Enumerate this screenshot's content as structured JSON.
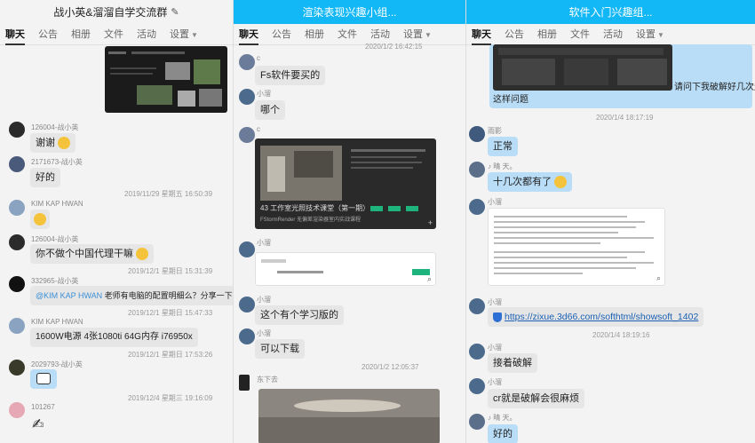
{
  "tab_labels": [
    "聊天",
    "公告",
    "相册",
    "文件",
    "活动",
    "设置"
  ],
  "p1": {
    "title": "战小英&溜溜自学交流群",
    "messages": {
      "m1_name": "126004-战小英",
      "m1_text": "谢谢",
      "m2_name": "2171673-战小英",
      "m2_text": "好的",
      "t1": "2019/11/29 星期五 16:50:39",
      "m3_name": "KIM KAP HWAN",
      "m4_name": "126004-战小英",
      "m4_text": "你不做个中国代理干嘛",
      "t2": "2019/12/1 星期日 15:31:39",
      "m5_name": "332965-战小英",
      "m5_mention": "@KIM KAP HWAN",
      "m5_text": " 老师有电脑的配置明细么？分享一下呗？",
      "t3": "2019/12/1 星期日 15:47:33",
      "m6_name": "KIM KAP HWAN",
      "m6_text": "1600W电源 4张1080ti 64G内存 i76950x",
      "t4": "2019/12/1 星期日 17:53:26",
      "m7_name": "2029793-战小英",
      "t5": "2019/12/4 星期三 19:16:09",
      "m8_name": "101267"
    }
  },
  "p2": {
    "title": "渲染表现兴趣小组...",
    "t1": "2020/1/2 16:42:15",
    "m1_name": "c",
    "m1_text": "Fs软件要买的",
    "m2_name": "小溜",
    "m2_text": "哪个",
    "m3_name": "c",
    "card_text": "43 工作室光照技术课堂（第一期）",
    "card_sub": "FStormRender 无偏差渲染器室内实战课程",
    "m4_name": "小溜",
    "m5_name": "小溜",
    "m5_text": "这个有个学习版的",
    "m6_name": "小溜",
    "m6_text": "可以下载",
    "t2": "2020/1/2 12:05:37",
    "m7_name": "东下去"
  },
  "p3": {
    "title": "软件入门兴趣组...",
    "m0_text": "请问下我破解好几次还是",
    "m0_text2": "这样问题",
    "t1": "2020/1/4 18:17:19",
    "m1_name": "雨影",
    "m1_text": "正常",
    "m2_name": "♪ 晴 天。",
    "m2_text": "十几次都有了",
    "m3_name": "小溜",
    "m4_name": "小溜",
    "m4_link": "https://zixue.3d66.com/softhtml/showsoft_1402",
    "t2": "2020/1/4 18:19:16",
    "m5_name": "小溜",
    "m5_text": "接着破解",
    "m6_name": "小溜",
    "m6_text": "cr就是破解会很麻烦",
    "m7_name": "♪ 晴 天。",
    "m7_text": "好的"
  },
  "colors": {
    "title_blue": "#12b7f5",
    "bubble_gray": "#e6e6e6",
    "bubble_blue": "#b9ddf7"
  }
}
